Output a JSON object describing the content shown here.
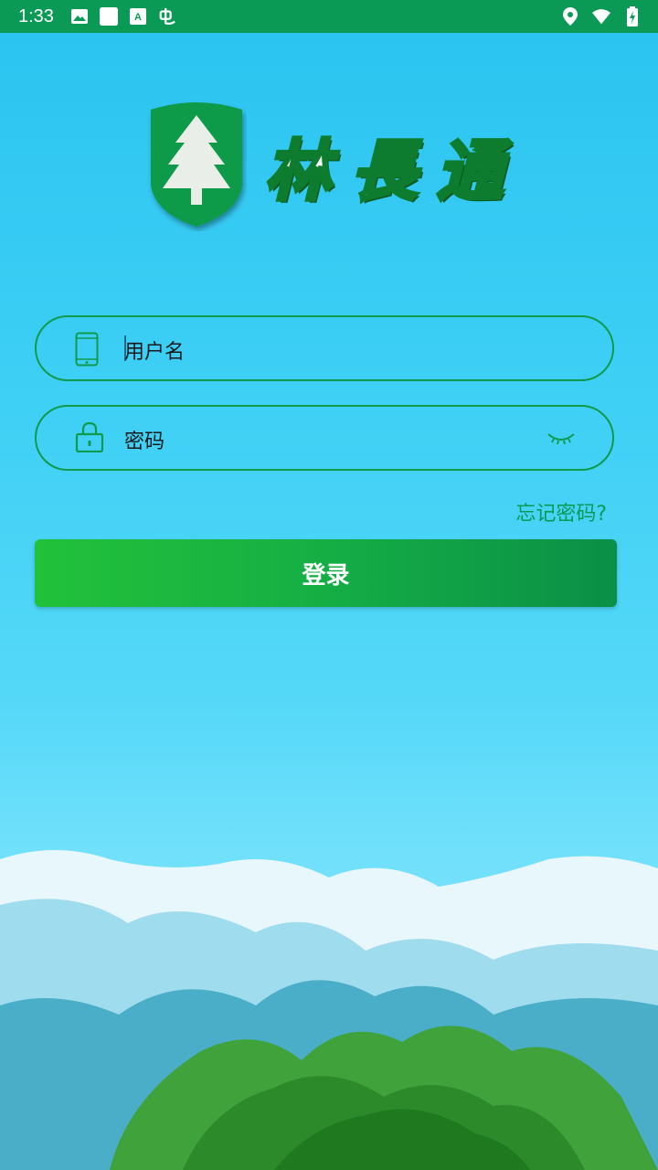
{
  "status_bar": {
    "time": "1:33",
    "left_icons": [
      "image-icon",
      "square-icon",
      "a-box-icon",
      "debug-icon"
    ],
    "right_icons": [
      "location-icon",
      "wifi-icon",
      "battery-icon"
    ]
  },
  "logo": {
    "title": "林長通"
  },
  "form": {
    "username_placeholder": "用户名",
    "password_placeholder": "密码",
    "forgot_label": "忘记密码?",
    "login_label": "登录"
  },
  "colors": {
    "brand_green": "#0b9a55",
    "button_gradient_start": "#22c13a",
    "button_gradient_end": "#0a8f47",
    "sky": "#29c3f0"
  }
}
